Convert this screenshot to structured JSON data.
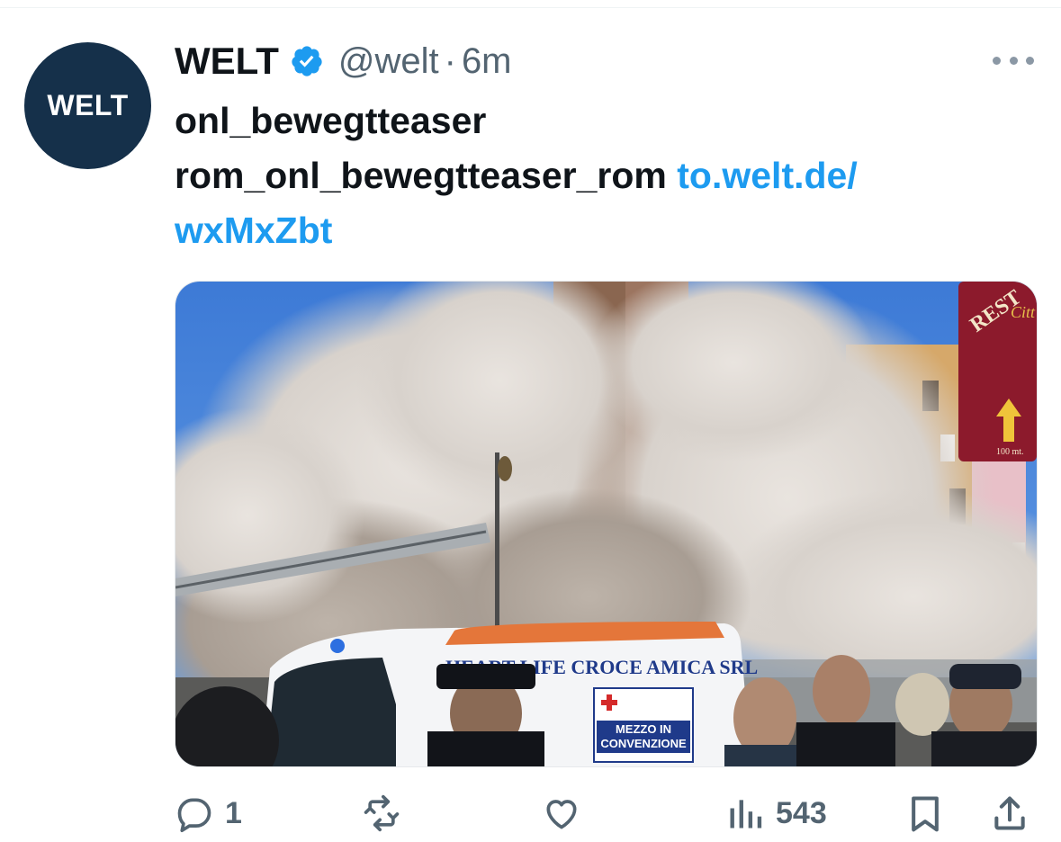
{
  "author": {
    "avatar_text": "WELT",
    "display_name": "WELT",
    "handle": "@welt",
    "separator": "·",
    "time": "6m"
  },
  "tweet": {
    "line1": "onl_bewegtteaser",
    "line2": "rom_onl_bewegtteaser_rom",
    "link_part1": "to.welt.de/",
    "link_part2": "wxMxZbt"
  },
  "media": {
    "ambulance_text": "HEART LIFE CROCE AMICA SRL",
    "panel_line1": "MEZZO IN",
    "panel_line2": "CONVENZIONE",
    "sign_text1": "REST",
    "sign_text2": "Citt",
    "sign_text3": "100 mt."
  },
  "actions": {
    "reply_count": "1",
    "retweet_count": "",
    "like_count": "",
    "views_count": "543"
  },
  "colors": {
    "link": "#1d9bf0",
    "verified": "#1d9bf0",
    "muted": "#536471",
    "avatar_bg": "#15304a"
  }
}
